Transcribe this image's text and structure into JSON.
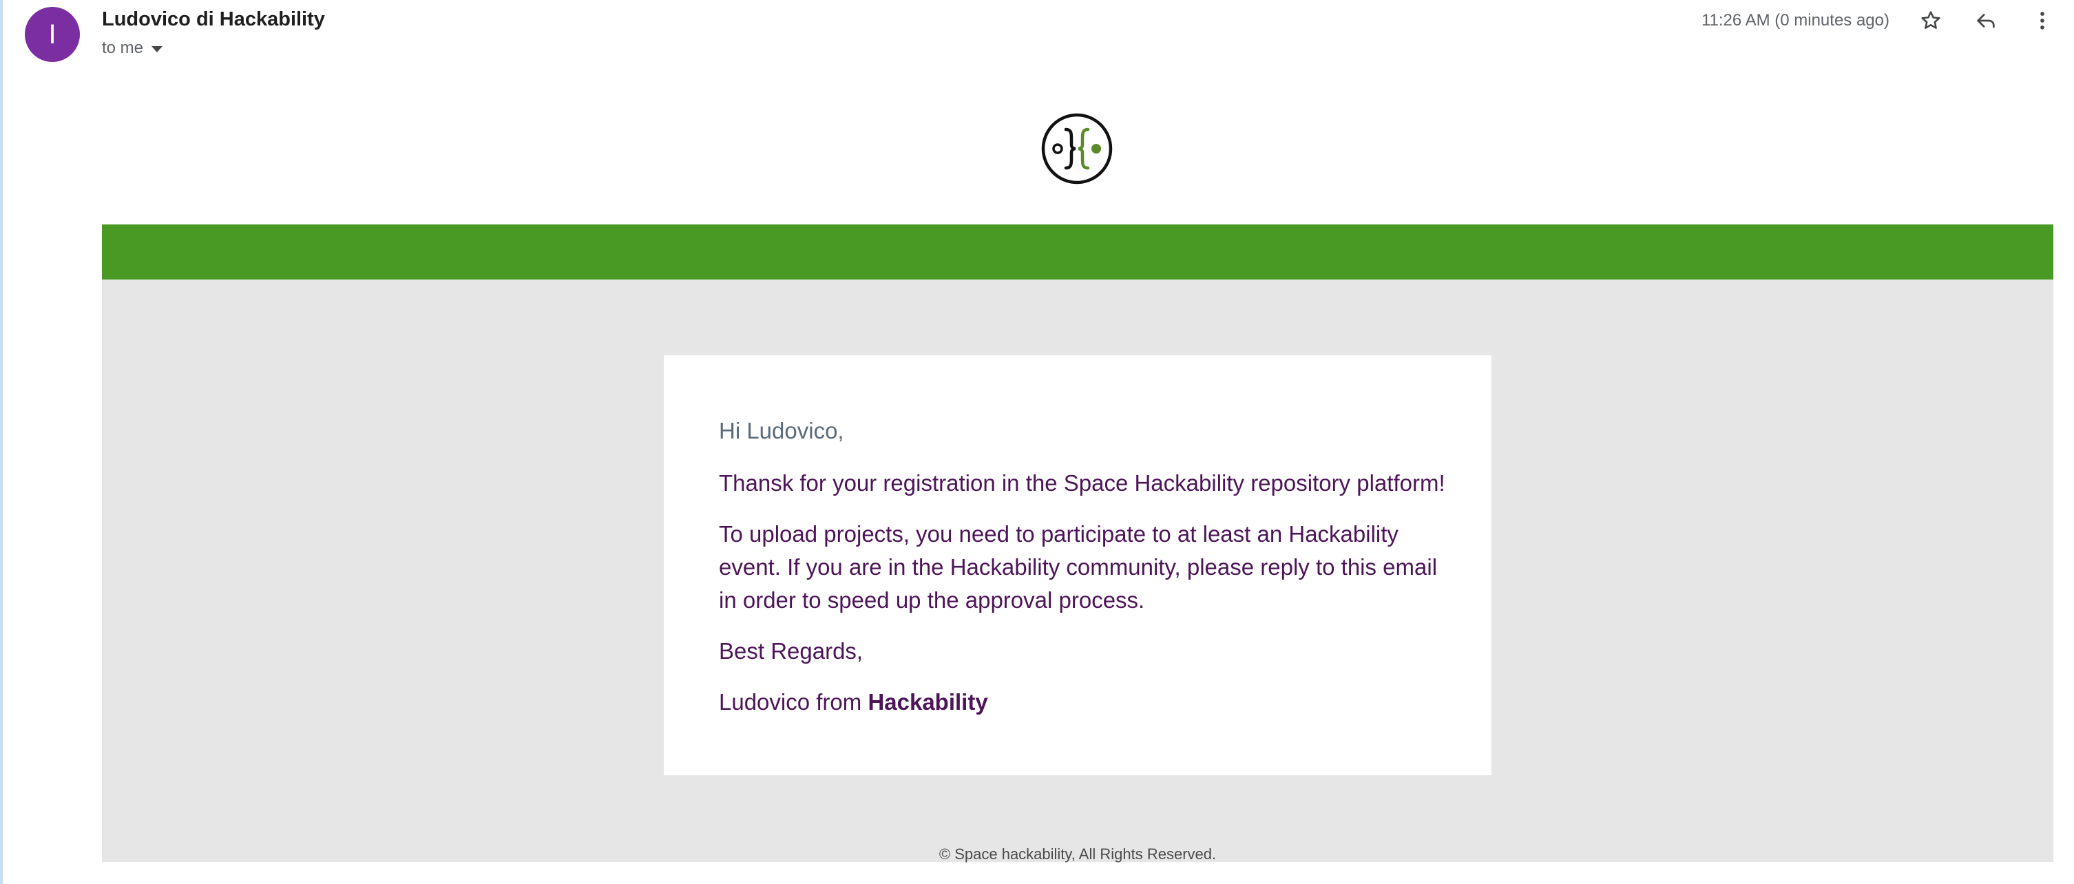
{
  "header": {
    "avatar_letter": "I",
    "sender_name": "Ludovico di Hackability",
    "recipients": "to me",
    "timestamp": "11:26 AM (0 minutes ago)",
    "icons": [
      "star-icon",
      "reply-icon",
      "more-vert-icon",
      "chevron-down-icon"
    ]
  },
  "email": {
    "greeting": "Hi Ludovico,",
    "paragraph_1": "Thansk for your registration in the Space Hackability repository platform!",
    "paragraph_2": "To upload projects, you need to participate to at least an Hackability event. If you are in the Hackability community, please reply to this email in order to speed up the approval process.",
    "closing": "Best Regards,",
    "signature_prefix": "Ludovico from ",
    "signature_org": "Hackability",
    "footer": "© Space hackability, All Rights Reserved."
  },
  "colors": {
    "avatar": "#7b2ea2",
    "green_bar": "#489a24",
    "gray_background": "#e6e6e6",
    "body_text": "#4d1558",
    "greeting_text": "#5a6b7a",
    "logo_accent": "#5a8a2a"
  }
}
